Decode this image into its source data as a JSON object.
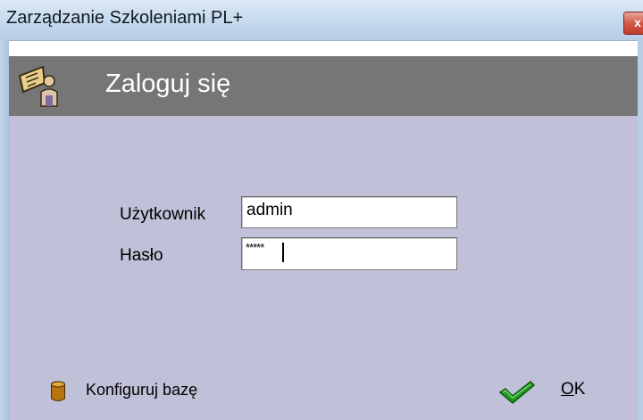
{
  "window": {
    "title": "Zarządzanie Szkoleniami PL+",
    "close_label": "x"
  },
  "header": {
    "title": "Zaloguj się",
    "icon": "login-user-icon"
  },
  "form": {
    "username_label": "Użytkownik",
    "username_value": "admin",
    "password_label": "Hasło",
    "password_mask": "*****"
  },
  "actions": {
    "configure_db_label": "Konfiguruj bazę",
    "configure_db_icon": "database-icon",
    "ok_label": "OK",
    "ok_icon": "checkmark-icon"
  },
  "colors": {
    "header_bg": "#767676",
    "content_bg": "#c0c0d8",
    "check_green": "#1f9b1f"
  }
}
